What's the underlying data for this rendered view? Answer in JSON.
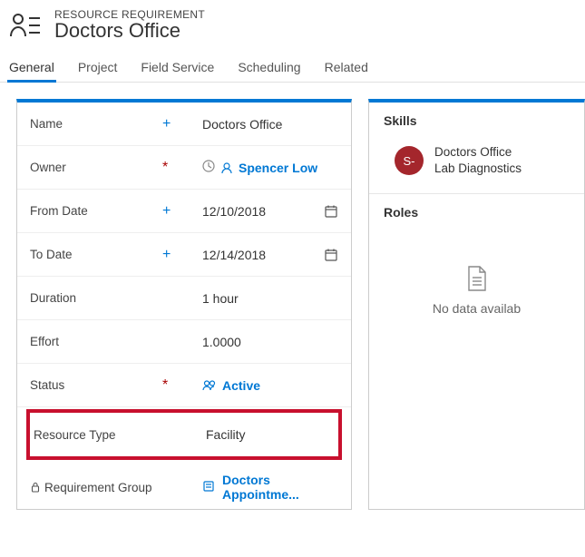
{
  "header": {
    "subtitle": "RESOURCE REQUIREMENT",
    "title": "Doctors Office"
  },
  "tabs": [
    "General",
    "Project",
    "Field Service",
    "Scheduling",
    "Related"
  ],
  "activeTab": "General",
  "fields": {
    "name": {
      "label": "Name",
      "value": "Doctors Office"
    },
    "owner": {
      "label": "Owner",
      "value": "Spencer Low"
    },
    "fromDate": {
      "label": "From Date",
      "value": "12/10/2018"
    },
    "toDate": {
      "label": "To Date",
      "value": "12/14/2018"
    },
    "duration": {
      "label": "Duration",
      "value": "1 hour"
    },
    "effort": {
      "label": "Effort",
      "value": "1.0000"
    },
    "status": {
      "label": "Status",
      "value": "Active"
    },
    "resourceType": {
      "label": "Resource Type",
      "value": "Facility"
    },
    "reqGroup": {
      "label": "Requirement Group",
      "value": "Doctors Appointme..."
    }
  },
  "right": {
    "skills": {
      "title": "Skills",
      "avatar": "S-",
      "line1": "Doctors Office",
      "line2": "Lab Diagnostics"
    },
    "roles": {
      "title": "Roles",
      "nodata": "No data availab"
    }
  }
}
